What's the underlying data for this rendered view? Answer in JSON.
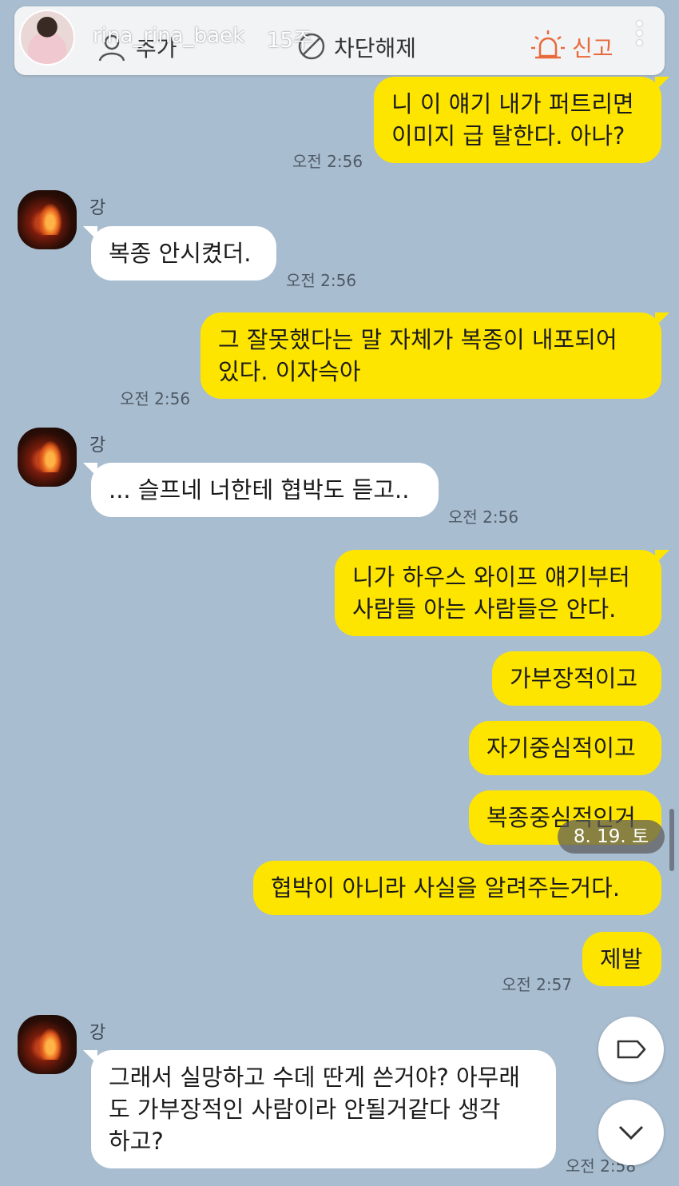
{
  "topbar": {
    "username": "rina_rina_baek",
    "time_ago": "15주",
    "friend_label": "추가",
    "unblock_label": "차단해제",
    "report_label": "신고",
    "accent_color": "#e8693a",
    "icons": [
      "profile-avatar",
      "add-friend-icon",
      "unblock-icon",
      "siren-icon",
      "more-vertical-icon"
    ]
  },
  "chat": {
    "messages": [
      {
        "from": "me",
        "lines": [
          "니 이 얘기 내가 퍼트리면",
          "이미지 급 탈한다. 아나?"
        ],
        "time": "오전 2:56"
      },
      {
        "from": "other",
        "sender": "강",
        "lines": [
          "복종 안시켰더."
        ],
        "time": "오전 2:56"
      },
      {
        "from": "me",
        "lines": [
          "그 잘못했다는 말 자체가 복종이 내포되어",
          "있다. 이자슥아"
        ],
        "time": "오전 2:56"
      },
      {
        "from": "other",
        "sender": "강",
        "lines": [
          "... 슬프네 너한테 협박도 듣고.."
        ],
        "time": "오전 2:56"
      },
      {
        "from": "me",
        "lines": [
          "니가 하우스 와이프 얘기부터",
          "사람들 아는 사람들은 안다."
        ]
      },
      {
        "from": "me",
        "lines": [
          "가부장적이고"
        ]
      },
      {
        "from": "me",
        "lines": [
          "자기중심적이고"
        ]
      },
      {
        "from": "me",
        "lines": [
          "복종중심적인거"
        ]
      },
      {
        "from": "me",
        "lines": [
          "협박이 아니라 사실을 알려주는거다."
        ]
      },
      {
        "from": "me",
        "lines": [
          "제발"
        ],
        "time": "오전 2:57"
      },
      {
        "from": "other",
        "sender": "강",
        "lines": [
          "그래서 실망하고 수데 딴게 쓴거야? 아무래",
          "도 가부장적인 사람이라 안될거같다 생각",
          "하고?"
        ],
        "time": "오전 2:58"
      }
    ],
    "date_chip": "8. 19. 토",
    "my_bubble_color": "#fee500",
    "other_bubble_color": "#ffffff",
    "background_color": "#a9bdd0"
  },
  "buttons": {
    "tag_icon": "tag-icon",
    "scroll_down_icon": "chevron-down-icon"
  }
}
